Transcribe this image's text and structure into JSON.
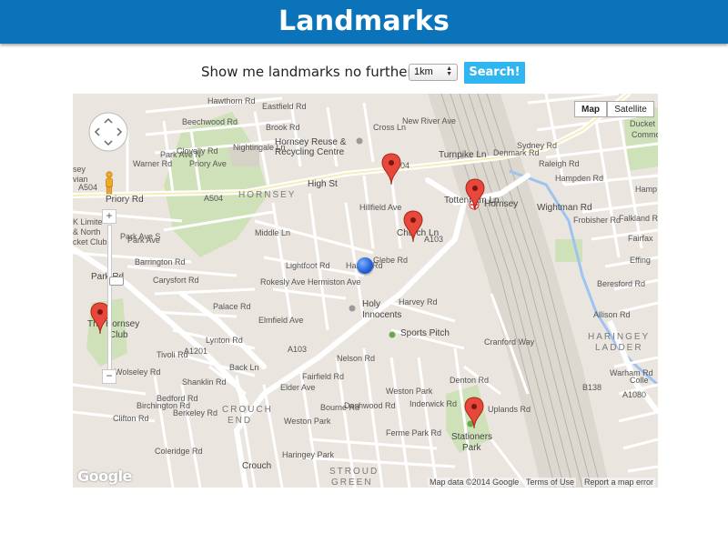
{
  "header": {
    "title": "Landmarks"
  },
  "controls": {
    "label": "Show me landmarks no further than:",
    "distance_selected": "1km",
    "search_label": "Search!"
  },
  "map": {
    "type_buttons": {
      "map": "Map",
      "satellite": "Satellite"
    },
    "attribution": {
      "data": "Map data ©2014 Google",
      "terms": "Terms of Use",
      "report": "Report a map error"
    },
    "google_logo": "Google",
    "zoom_in": "+",
    "zoom_out": "−",
    "labels": {
      "hawthorn": "Hawthorn Rd",
      "eastfield": "Eastfield Rd",
      "beechwood": "Beechwood Rd",
      "brook": "Brook Rd",
      "hornsey_reuse": "Hornsey Reuse &",
      "recycling": "Recycling Centre",
      "clovelly": "Clovelly Rd",
      "warner": "Warner Rd",
      "park_ave_n": "Park Ave N",
      "priory_ave": "Priory Ave",
      "nightingale": "Nightingale Ln",
      "hornsey_area": "HORNSEY",
      "high_st": "High St",
      "a504": "A504",
      "priory_rd": "Priory Rd",
      "a504b": "A504",
      "park_ave_s": "Park Ave S",
      "middle_ln": "Middle Ln",
      "hillfield": "Hillfield Ave",
      "harold": "Harold Rd",
      "glebe": "Glebe Rd",
      "church_ln": "Church Ln",
      "a103a": "A103",
      "tottenham": "Tottenham Ln",
      "turnpike": "Turnpike Ln",
      "hornsey_station": "Hornsey",
      "sydney": "Sydney Rd",
      "raleigh": "Raleigh Rd",
      "hampden": "Hampden Rd",
      "frobisher": "Frobisher Rd",
      "wightman": "Wightman Rd",
      "falkland": "Falkland R",
      "fairfax": "Fairfax",
      "effingham": "Effing",
      "denmark": "Denmark Rd",
      "new_river": "New River Ave",
      "cross_ln": "Cross Ln",
      "barrington": "Barrington Rd",
      "carysfort": "Carysfort Rd",
      "lightfoot": "Lightfoot Rd",
      "rokesly": "Rokesly Ave",
      "hermiston": "Hermiston Ave",
      "palace": "Palace Rd",
      "elmfield": "Elmfield Ave",
      "holy": "Holy",
      "innocents": "Innocents",
      "harvey": "Harvey Rd",
      "sports": "Sports Pitch",
      "park_rd": "Park Rd",
      "hornsey_club": "The Hornsey",
      "club": "Club",
      "lynton": "Lynton Rd",
      "a1201": "A1201",
      "a103b": "A103",
      "tivoli": "Tivoli Rd",
      "wolseley": "Wolseley Rd",
      "shanklin": "Shanklin Rd",
      "back_ln": "Back Ln",
      "elder": "Elder Ave",
      "fairfield": "Fairfield Rd",
      "nelson": "Nelson Rd",
      "weston_park": "Weston Park",
      "weston_park2": "Weston Park",
      "bedford": "Bedford Rd",
      "birchington": "Birchington Rd",
      "clifton": "Clifton Rd",
      "berkeley": "Berkeley Rd",
      "crouch": "CROUCH",
      "end": "END",
      "coleridge": "Coleridge Rd",
      "bourne": "Bourne Rd",
      "dashwood": "Dashwood Rd",
      "haringey_park": "Haringey Park",
      "ferme": "Ferme Park Rd",
      "inderwick": "Inderwick Rd",
      "stroud": "STROUD",
      "green": "GREEN",
      "cranford": "Cranford Way",
      "denton": "Denton Rd",
      "uplands": "Uplands Rd",
      "stationers": "Stationers",
      "stationers_park": "Park",
      "haringey_ladder": "HARINGEY",
      "ladder": "LADDER",
      "beresford": "Beresford Rd",
      "allison": "Allison Rd",
      "warham": "Warham Rd",
      "b138": "B138",
      "a1080": "A1080",
      "colle": "Colle",
      "ducketts": "Ducket",
      "commo": "Commo",
      "k_limited": "K Limite",
      "north": "& North",
      "cket_club": "cket Club",
      "sey": "sey",
      "vian": "vian",
      "park_ave": "Park Ave",
      "hamp": "Hamp",
      "a504c": "A504",
      "crouch_hill": "Crouch"
    }
  }
}
